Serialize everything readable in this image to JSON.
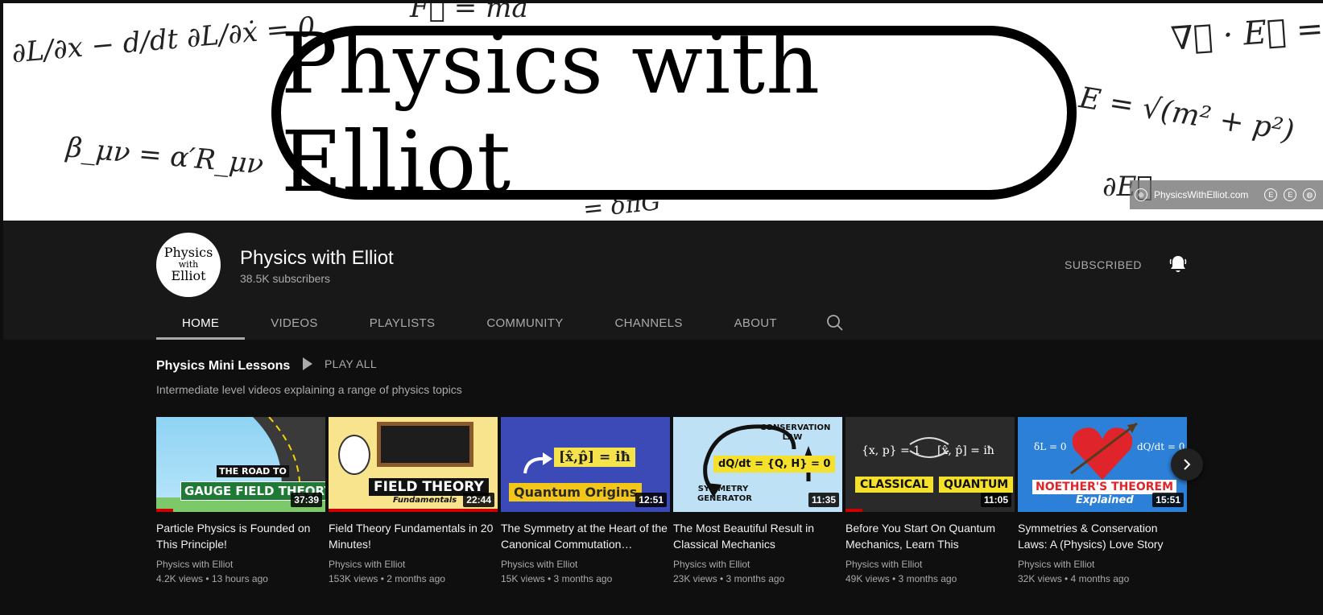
{
  "banner": {
    "title": "Physics with Elliot",
    "equations": [
      "∂L/∂x − d/dt ∂L/∂ẋ = 0",
      "F⃗ = ma",
      "∇⃗ · E⃗ = ρ",
      "E = √(m² + p²)",
      "β_μν = α′R_μν",
      "∂E⃗",
      "= δπG"
    ],
    "link_text": "PhysicsWithElliot.com"
  },
  "channel": {
    "avatar_lines": [
      "Physics",
      "with",
      "Elliot"
    ],
    "name": "Physics with Elliot",
    "subscribers": "38.5K subscribers",
    "subscribe_label": "SUBSCRIBED"
  },
  "tabs": [
    {
      "label": "HOME",
      "active": true
    },
    {
      "label": "VIDEOS",
      "active": false
    },
    {
      "label": "PLAYLISTS",
      "active": false
    },
    {
      "label": "COMMUNITY",
      "active": false
    },
    {
      "label": "CHANNELS",
      "active": false
    },
    {
      "label": "ABOUT",
      "active": false
    }
  ],
  "shelf": {
    "title": "Physics Mini Lessons",
    "play_all": "PLAY ALL",
    "description": "Intermediate level videos explaining a range of physics topics"
  },
  "videos": [
    {
      "title": "Particle Physics is Founded on This Principle!",
      "channel": "Physics with Elliot",
      "meta": "4.2K views • 13 hours ago",
      "duration": "37:39",
      "thumb_text": [
        "THE ROAD TO",
        "GAUGE FIELD THEORY"
      ],
      "watched": 0.1
    },
    {
      "title": "Field Theory Fundamentals in 20 Minutes!",
      "channel": "Physics with Elliot",
      "meta": "153K views • 2 months ago",
      "duration": "22:44",
      "thumb_text": [
        "FIELD THEORY",
        "Fundamentals"
      ],
      "watched": 1.0
    },
    {
      "title": "The Symmetry at the Heart of the Canonical Commutation…",
      "channel": "Physics with Elliot",
      "meta": "15K views • 3 months ago",
      "duration": "12:51",
      "thumb_text": [
        "[x̂,p̂] = iħ",
        "Quantum Origins"
      ],
      "watched": 0
    },
    {
      "title": "The Most Beautiful Result in Classical Mechanics",
      "channel": "Physics with Elliot",
      "meta": "23K views • 3 months ago",
      "duration": "11:35",
      "thumb_text": [
        "CONSERVATION LAW",
        "dQ/dt = {Q, H} = 0",
        "SYMMETRY GENERATOR"
      ],
      "watched": 0
    },
    {
      "title": "Before You Start On Quantum Mechanics, Learn This",
      "channel": "Physics with Elliot",
      "meta": "49K views • 3 months ago",
      "duration": "11:05",
      "thumb_text": [
        "{x, p} = 1",
        "[x̂, p̂] = iħ",
        "CLASSICAL",
        "QUANTUM"
      ],
      "watched": 0.1
    },
    {
      "title": "Symmetries & Conservation Laws: A (Physics) Love Story",
      "channel": "Physics with Elliot",
      "meta": "32K views • 4 months ago",
      "duration": "15:51",
      "thumb_text": [
        "δL = 0",
        "dQ/dt = 0",
        "NOETHER'S THEOREM",
        "Explained"
      ],
      "watched": 0
    }
  ],
  "colors": {
    "page_bg": "#0f0f0f",
    "header_bg": "#181818",
    "accent_red": "#cc0000",
    "muted_text": "#aaaaaa"
  }
}
